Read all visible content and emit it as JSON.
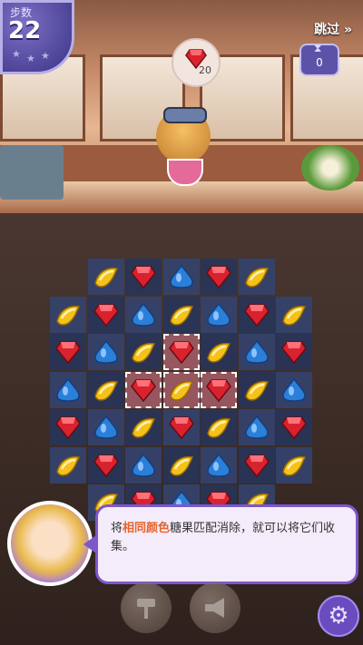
{
  "hud": {
    "moves_label": "步数",
    "moves_value": "22",
    "skip_label": "跳过 »",
    "goal": {
      "icon": "red-gem-icon",
      "count": "20"
    },
    "timer": {
      "icon": "hourglass-icon",
      "count": "0"
    }
  },
  "tutorial": {
    "before": "将",
    "highlight": "相同颜色",
    "after": "糖果匹配消除，就可以将它们收集。"
  },
  "board": {
    "cols": 7,
    "rows": 7,
    "grid": [
      [
        "empty",
        "yellow",
        "red",
        "blue",
        "red",
        "yellow",
        "empty"
      ],
      [
        "yellow",
        "red",
        "blue",
        "yellow",
        "blue",
        "red",
        "yellow"
      ],
      [
        "red",
        "blue",
        "yellow",
        "red",
        "yellow",
        "blue",
        "red"
      ],
      [
        "blue",
        "yellow",
        "red",
        "yellow",
        "red",
        "yellow",
        "blue"
      ],
      [
        "red",
        "blue",
        "yellow",
        "red",
        "yellow",
        "blue",
        "red"
      ],
      [
        "yellow",
        "red",
        "blue",
        "yellow",
        "blue",
        "red",
        "yellow"
      ],
      [
        "empty",
        "yellow",
        "red",
        "blue",
        "red",
        "yellow",
        "empty"
      ]
    ],
    "highlighted_cells": [
      [
        2,
        3
      ],
      [
        3,
        2
      ],
      [
        3,
        3
      ],
      [
        3,
        4
      ]
    ]
  },
  "colors": {
    "red": "#d8232e",
    "blue": "#2b7fd8",
    "yellow": "#f4c21a",
    "accent": "#7c58c8",
    "highlight_text": "#e8642c"
  },
  "boosters": [
    {
      "icon": "hammer-icon"
    },
    {
      "icon": "megaphone-icon"
    }
  ],
  "settings": {
    "icon": "gear-icon"
  }
}
